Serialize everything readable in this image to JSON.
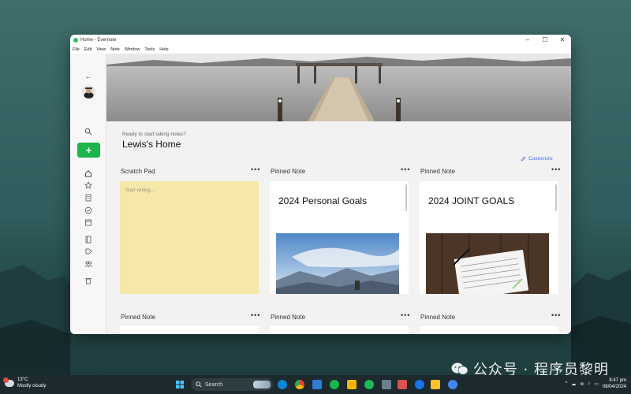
{
  "window": {
    "title": "Home - Evernote",
    "menu": [
      "File",
      "Edit",
      "View",
      "Note",
      "Window",
      "Tools",
      "Help"
    ],
    "controls": {
      "minimize": "–",
      "maximize": "☐",
      "close": "✕"
    }
  },
  "sidebar": {
    "back": "←",
    "new_label": "+",
    "icons": [
      "back-arrow-icon",
      "search-icon",
      "home-icon",
      "star-icon",
      "notes-icon",
      "tasks-icon",
      "calendar-icon",
      "notebook-icon",
      "tags-icon",
      "shared-icon",
      "trash-icon",
      "help-icon",
      "keyboard-icon"
    ]
  },
  "home": {
    "greeting": "Ready to start taking notes?",
    "title": "Lewis's Home",
    "customize": "Customize"
  },
  "widgets": [
    {
      "heading": "Scratch Pad",
      "more": "•••",
      "placeholder": "Start writing..."
    },
    {
      "heading": "Pinned Note",
      "more": "•••",
      "note_title": "2024 Personal Goals"
    },
    {
      "heading": "Pinned Note",
      "more": "•••",
      "note_title": "2024 JOINT GOALS"
    },
    {
      "heading": "Pinned Note",
      "more": "•••"
    },
    {
      "heading": "Pinned Note",
      "more": "•••"
    },
    {
      "heading": "Pinned Note",
      "more": "•••"
    }
  ],
  "taskbar": {
    "weather_badge": "1",
    "temperature": "13°C",
    "condition": "Mostly cloudy",
    "search_label": "Search",
    "time": "8:47 pm",
    "date": "08/04/2024"
  },
  "watermark": "公众号 · 程序员黎明",
  "colors": {
    "accent_green": "#1cb44b",
    "link_blue": "#4a6ef5",
    "scratch_yellow": "#f5e8a8"
  }
}
